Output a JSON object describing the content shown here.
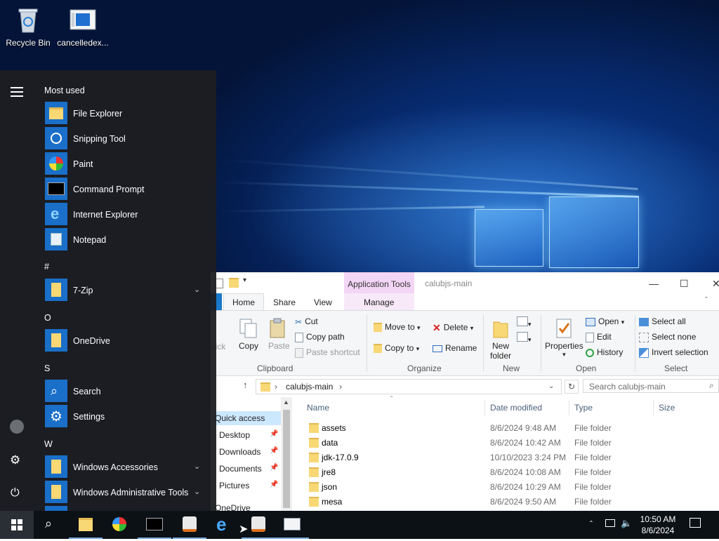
{
  "desktop": {
    "icons": [
      {
        "label": "Recycle Bin"
      },
      {
        "label": "cancelledex..."
      }
    ]
  },
  "start_menu": {
    "most_used_header": "Most used",
    "most_used": [
      {
        "label": "File Explorer"
      },
      {
        "label": "Snipping Tool"
      },
      {
        "label": "Paint"
      },
      {
        "label": "Command Prompt"
      },
      {
        "label": "Internet Explorer"
      },
      {
        "label": "Notepad"
      }
    ],
    "sections": [
      {
        "header": "#",
        "items": [
          {
            "label": "7-Zip"
          }
        ]
      },
      {
        "header": "O",
        "items": [
          {
            "label": "OneDrive"
          }
        ]
      },
      {
        "header": "S",
        "items": [
          {
            "label": "Search"
          },
          {
            "label": "Settings"
          }
        ]
      },
      {
        "header": "W",
        "items": [
          {
            "label": "Windows Accessories"
          },
          {
            "label": "Windows Administrative Tools"
          }
        ]
      }
    ]
  },
  "explorer": {
    "title": "calubjs-main",
    "context_tab": "Application Tools",
    "tabs": {
      "home": "Home",
      "share": "Share",
      "view": "View",
      "manage": "Manage"
    },
    "ribbon": {
      "quick": "uick",
      "copy": "Copy",
      "paste": "Paste",
      "cut": "Cut",
      "copy_path": "Copy path",
      "paste_shortcut": "Paste shortcut",
      "clipboard_group": "Clipboard",
      "move_to": "Move to",
      "copy_to": "Copy to",
      "delete": "Delete",
      "rename": "Rename",
      "organize_group": "Organize",
      "new_folder_line1": "New",
      "new_folder_line2": "folder",
      "new_group": "New",
      "properties": "Properties",
      "open": "Open",
      "edit": "Edit",
      "history": "History",
      "open_group": "Open",
      "select_all": "Select all",
      "select_none": "Select none",
      "invert_selection": "Invert selection",
      "select_group": "Select"
    },
    "address": {
      "path": "calubjs-main",
      "search_placeholder": "Search calubjs-main"
    },
    "nav": {
      "quick_access": "Quick access",
      "items": [
        {
          "label": "Desktop"
        },
        {
          "label": "Downloads"
        },
        {
          "label": "Documents"
        },
        {
          "label": "Pictures"
        }
      ],
      "onedrive": "OneDrive"
    },
    "columns": {
      "name": "Name",
      "date": "Date modified",
      "type": "Type",
      "size": "Size"
    },
    "rows": [
      {
        "name": "assets",
        "date": "8/6/2024 9:48 AM",
        "type": "File folder"
      },
      {
        "name": "data",
        "date": "8/6/2024 10:42 AM",
        "type": "File folder"
      },
      {
        "name": "jdk-17.0.9",
        "date": "10/10/2023 3:24 PM",
        "type": "File folder"
      },
      {
        "name": "jre8",
        "date": "8/6/2024 10:08 AM",
        "type": "File folder"
      },
      {
        "name": "json",
        "date": "8/6/2024 10:29 AM",
        "type": "File folder"
      },
      {
        "name": "mesa",
        "date": "8/6/2024 9:50 AM",
        "type": "File folder"
      }
    ]
  },
  "taskbar": {
    "time": "10:50 AM",
    "date": "8/6/2024"
  }
}
